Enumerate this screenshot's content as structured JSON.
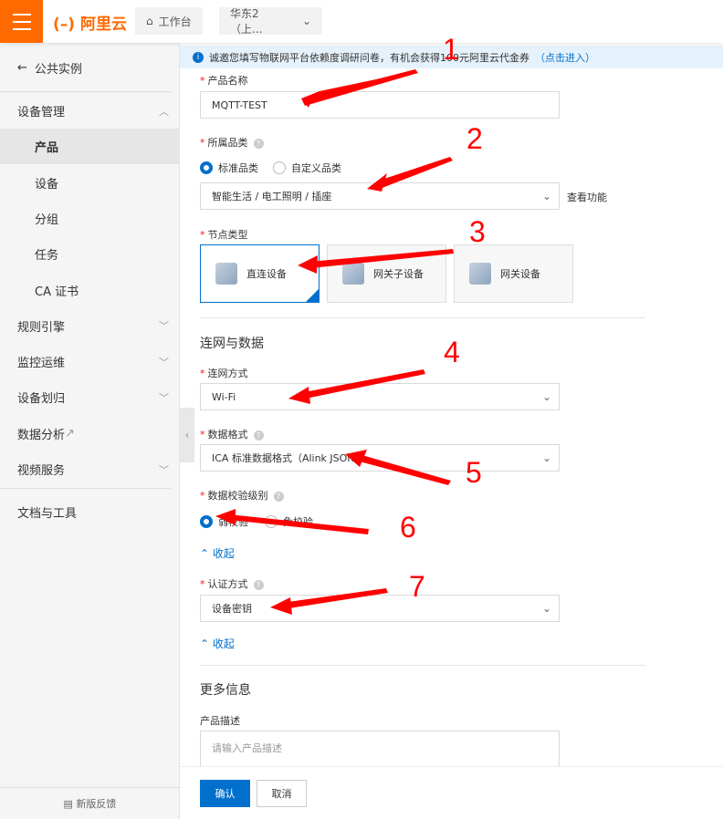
{
  "header": {
    "brand": "阿里云",
    "workbench": "工作台",
    "region": "华东2（上..."
  },
  "sidebar": {
    "back": "公共实例",
    "items": [
      {
        "label": "设备管理",
        "chevron": "up"
      },
      {
        "label": "产品",
        "sub": true,
        "active": true
      },
      {
        "label": "设备",
        "sub": true
      },
      {
        "label": "分组",
        "sub": true
      },
      {
        "label": "任务",
        "sub": true
      },
      {
        "label": "CA 证书",
        "sub": true
      },
      {
        "label": "规则引擎",
        "chevron": "down"
      },
      {
        "label": "监控运维",
        "chevron": "down"
      },
      {
        "label": "设备划归",
        "chevron": "down"
      },
      {
        "label": "数据分析",
        "external": true
      },
      {
        "label": "视频服务",
        "chevron": "down"
      }
    ],
    "docs": "文档与工具",
    "feedback": "新版反馈"
  },
  "banner": {
    "text": "诚邀您填写物联网平台依赖度调研问卷，有机会获得100元阿里云代金券",
    "link": "（点击进入）"
  },
  "form": {
    "product_name": {
      "label": "产品名称",
      "value": "MQTT-TEST"
    },
    "category": {
      "label": "所属品类",
      "options": [
        "标准品类",
        "自定义品类"
      ],
      "value": "智能生活 / 电工照明 / 插座",
      "view": "查看功能"
    },
    "node_type": {
      "label": "节点类型",
      "options": [
        "直连设备",
        "网关子设备",
        "网关设备"
      ]
    },
    "network_section": "连网与数据",
    "network": {
      "label": "连网方式",
      "value": "Wi-Fi"
    },
    "data_format": {
      "label": "数据格式",
      "value": "ICA 标准数据格式（Alink JSON）"
    },
    "check_level": {
      "label": "数据校验级别",
      "options": [
        "弱校验",
        "免校验"
      ]
    },
    "collapse1": "收起",
    "auth": {
      "label": "认证方式",
      "value": "设备密钥"
    },
    "collapse2": "收起",
    "more_section": "更多信息",
    "desc": {
      "label": "产品描述",
      "placeholder": "请输入产品描述"
    },
    "confirm": "确认",
    "cancel": "取消"
  },
  "annotations": [
    "1",
    "2",
    "3",
    "4",
    "5",
    "6",
    "7"
  ],
  "colors": {
    "accent": "#ff6a00",
    "primary": "#0070cc",
    "annotation": "#ff0000"
  }
}
